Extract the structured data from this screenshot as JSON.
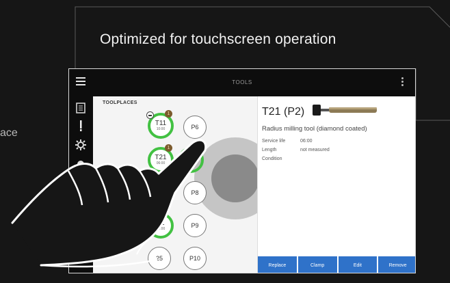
{
  "callout": "Optimized for touchscreen operation",
  "side_fragment": "ace",
  "app": {
    "title": "TOOLS",
    "toolplaces_label": "TOOLPLACES",
    "tools": [
      {
        "name": "T11",
        "sub": "10:00"
      },
      {
        "name": "T21",
        "sub": "06:00"
      },
      {
        "name": "T2",
        "sub": ""
      },
      {
        "name": "32",
        "sub": "06:00"
      },
      {
        "name": "25",
        "sub": ""
      }
    ],
    "places": [
      "P6",
      "P8",
      "P9",
      "P10"
    ],
    "selected_tool_partial": "T2",
    "badge_label": "1",
    "detail": {
      "title": "T21 (P2)",
      "description": "Radius milling tool (diamond coated)",
      "rows": [
        {
          "key": "Service life",
          "value": "06:00"
        },
        {
          "key": "Length",
          "value": "not measured"
        },
        {
          "key": "Condition",
          "value": ""
        }
      ]
    },
    "actions": [
      "Replace",
      "Clamp",
      "Edit",
      "Remove"
    ],
    "colors": {
      "ring": "#42c142",
      "button": "#2f72c9",
      "bar": "#0d0d0d"
    }
  }
}
